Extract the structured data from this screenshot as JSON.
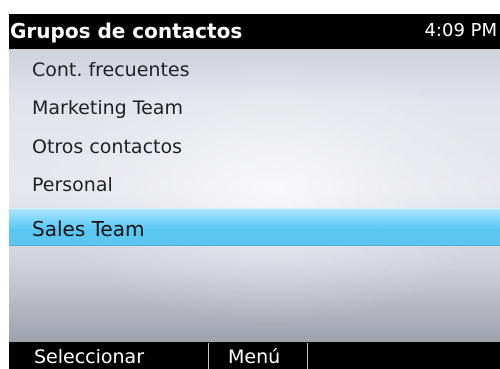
{
  "header": {
    "title": "Grupos de contactos",
    "time": "4:09 PM"
  },
  "list": {
    "items": [
      {
        "label": "Cont. frecuentes"
      },
      {
        "label": "Marketing Team"
      },
      {
        "label": "Otros contactos"
      },
      {
        "label": "Personal"
      },
      {
        "label": "Sales Team"
      }
    ],
    "selected_label": "Sales Team"
  },
  "softkeys": {
    "left": "Seleccionar",
    "middle": "Menú",
    "right": ""
  },
  "colors": {
    "frame": "#000000",
    "selection": "#58c8f4",
    "text": "#1e1f23"
  }
}
